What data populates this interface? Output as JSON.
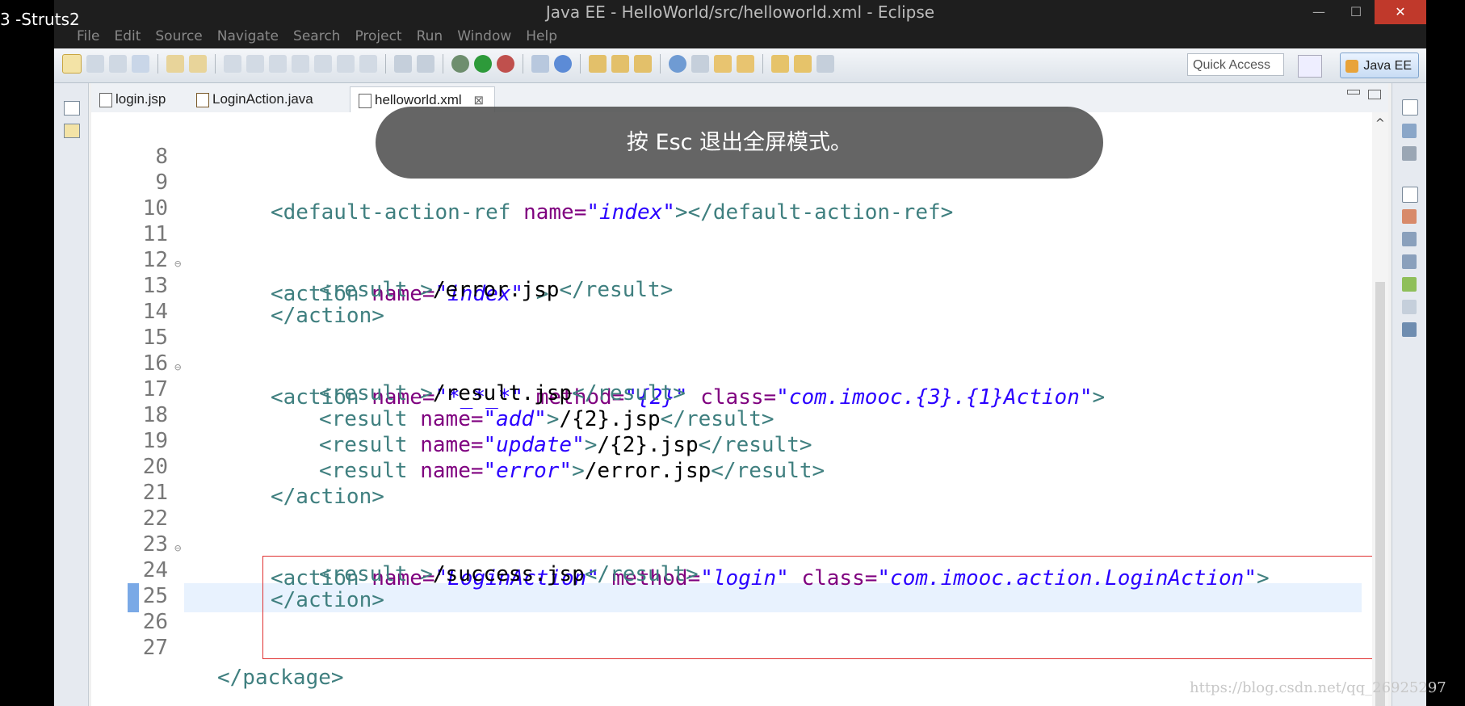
{
  "video_title": "3 ​​​​​-​​Struts2",
  "window": {
    "title": "Java EE - HelloWorld/src/helloworld.xml - Eclipse"
  },
  "menu": [
    "File",
    "Edit",
    "Source",
    "Navigate",
    "Search",
    "Project",
    "Run",
    "Window",
    "Help"
  ],
  "toolbar": {
    "quick_access": "Quick Access",
    "perspective": "Java EE"
  },
  "tabs": [
    {
      "label": "login.jsp",
      "active": false
    },
    {
      "label": "LoginAction.java",
      "active": false
    },
    {
      "label": "helloworld.xml",
      "active": true,
      "close": "⊠"
    }
  ],
  "fullscreen_toast": "按 Esc 退出全屏模式。",
  "editor": {
    "current_line": 23,
    "lines": [
      {
        "n": "8",
        "fold": ""
      },
      {
        "n": "9",
        "fold": ""
      },
      {
        "n": "10",
        "fold": ""
      },
      {
        "n": "11",
        "fold": "⊖"
      },
      {
        "n": "12",
        "fold": ""
      },
      {
        "n": "13",
        "fold": ""
      },
      {
        "n": "14",
        "fold": ""
      },
      {
        "n": "15",
        "fold": "⊖"
      },
      {
        "n": "16",
        "fold": ""
      },
      {
        "n": "17",
        "fold": ""
      },
      {
        "n": "18",
        "fold": ""
      },
      {
        "n": "19",
        "fold": ""
      },
      {
        "n": "20",
        "fold": ""
      },
      {
        "n": "21",
        "fold": ""
      },
      {
        "n": "22",
        "fold": "⊖"
      },
      {
        "n": "23",
        "fold": ""
      },
      {
        "n": "24",
        "fold": ""
      },
      {
        "n": "25",
        "fold": ""
      },
      {
        "n": "26",
        "fold": ""
      },
      {
        "n": "27",
        "fold": ""
      }
    ],
    "code": {
      "l9": {
        "indent": "    ",
        "open": "<",
        "tag": "default-action-ref",
        "attr": " name=",
        "val": "\"index\"",
        "close": "></default-action-ref>"
      },
      "l11": {
        "indent": "    ",
        "open": "<",
        "tag": "action",
        "attr": " name=",
        "val": "\"index\"",
        "close": " >"
      },
      "l12": {
        "indent": "        ",
        "pre": "<result >",
        "text": "/error.jsp",
        "post": "</result>"
      },
      "l13": {
        "indent": "    ",
        "pre": "</action>"
      },
      "l15": {
        "indent": "    ",
        "open": "<action",
        "a1": " name=",
        "v1": "\"*_*_*\"",
        "a2": " method=",
        "v2": "\"{2}\"",
        "a3": " class=",
        "v3": "\"com.imooc.{3}.{1}Action\"",
        "close": ">"
      },
      "l16": {
        "indent": "        ",
        "pre": "<result >",
        "text": "/result.jsp",
        "post": "</result>"
      },
      "l17": {
        "indent": "        ",
        "open": "<result",
        "attr": " name=",
        "val": "\"add\"",
        "pre": ">",
        "text": "/{2}.jsp",
        "post": "</result>"
      },
      "l18": {
        "indent": "        ",
        "open": "<result",
        "attr": " name=",
        "val": "\"update\"",
        "pre": ">",
        "text": "/{2}.jsp",
        "post": "</result>"
      },
      "l19": {
        "indent": "        ",
        "open": "<result",
        "attr": " name=",
        "val": "\"error\"",
        "pre": ">",
        "text": "/error.jsp",
        "post": "</result>"
      },
      "l20": {
        "indent": "    ",
        "pre": "</action>"
      },
      "l22": {
        "indent": "    ",
        "open": "<action",
        "a1": " name=",
        "v1": "\"LoginAction\"",
        "a2": " method=",
        "v2": "\"login\"",
        "a3": " class=",
        "v3": "\"com.imooc.action.LoginAction\"",
        "close": ">"
      },
      "l23": {
        "indent": "        ",
        "pre": "<result >",
        "text": "/success.jsp",
        "post": "</result>"
      },
      "l24": {
        "indent": "    ",
        "pre": "</action>"
      },
      "l27": {
        "indent": "",
        "pre": "</package>"
      }
    }
  },
  "watermark": "https://blog.csdn.net/qq_26925297"
}
